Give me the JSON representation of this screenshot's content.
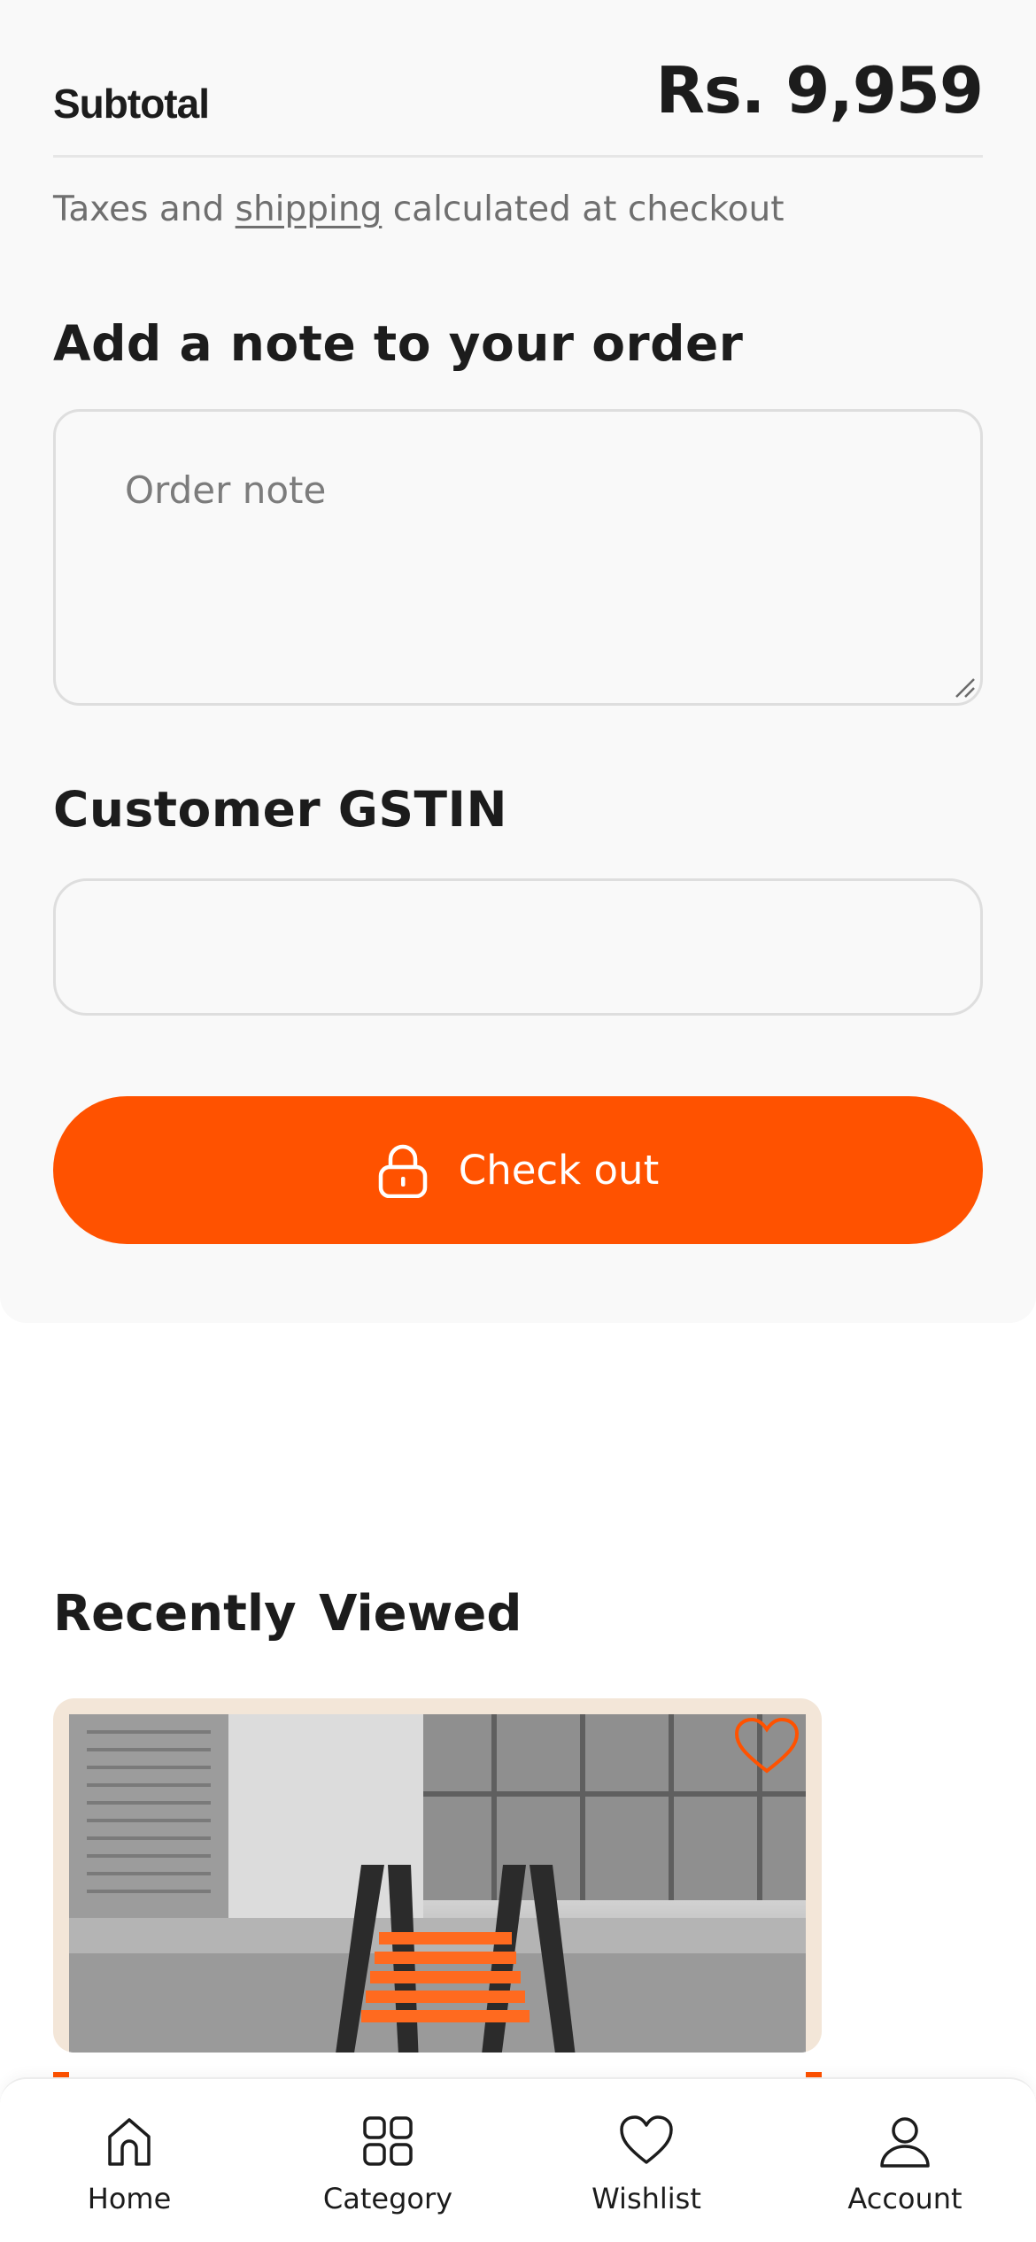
{
  "summary": {
    "subtotal_label": "Subtotal",
    "subtotal_value": "Rs. 9,959",
    "tax_prefix": "Taxes and ",
    "tax_link": "shipping",
    "tax_suffix": " calculated at checkout"
  },
  "order_note": {
    "heading": "Add a note to your order",
    "placeholder": "Order note",
    "value": ""
  },
  "gstin": {
    "heading": "Customer GSTIN",
    "value": ""
  },
  "checkout": {
    "label": "Check out",
    "icon": "lock-icon"
  },
  "recently_viewed": {
    "heading": "Recently Viewed",
    "items": [
      {
        "image": "telescopic-ladder-product-image",
        "wishlist_icon": "heart-outline-icon"
      }
    ]
  },
  "bottom_nav": {
    "items": [
      {
        "label": "Home",
        "icon": "home-icon"
      },
      {
        "label": "Category",
        "icon": "grid-icon"
      },
      {
        "label": "Wishlist",
        "icon": "heart-icon"
      },
      {
        "label": "Account",
        "icon": "user-icon"
      }
    ]
  },
  "colors": {
    "accent": "#ff5200",
    "card_background": "#f9f9f9",
    "product_card_background": "#f3e6d8",
    "text": "#1c1c1c",
    "muted_text": "#6f6f6f"
  }
}
